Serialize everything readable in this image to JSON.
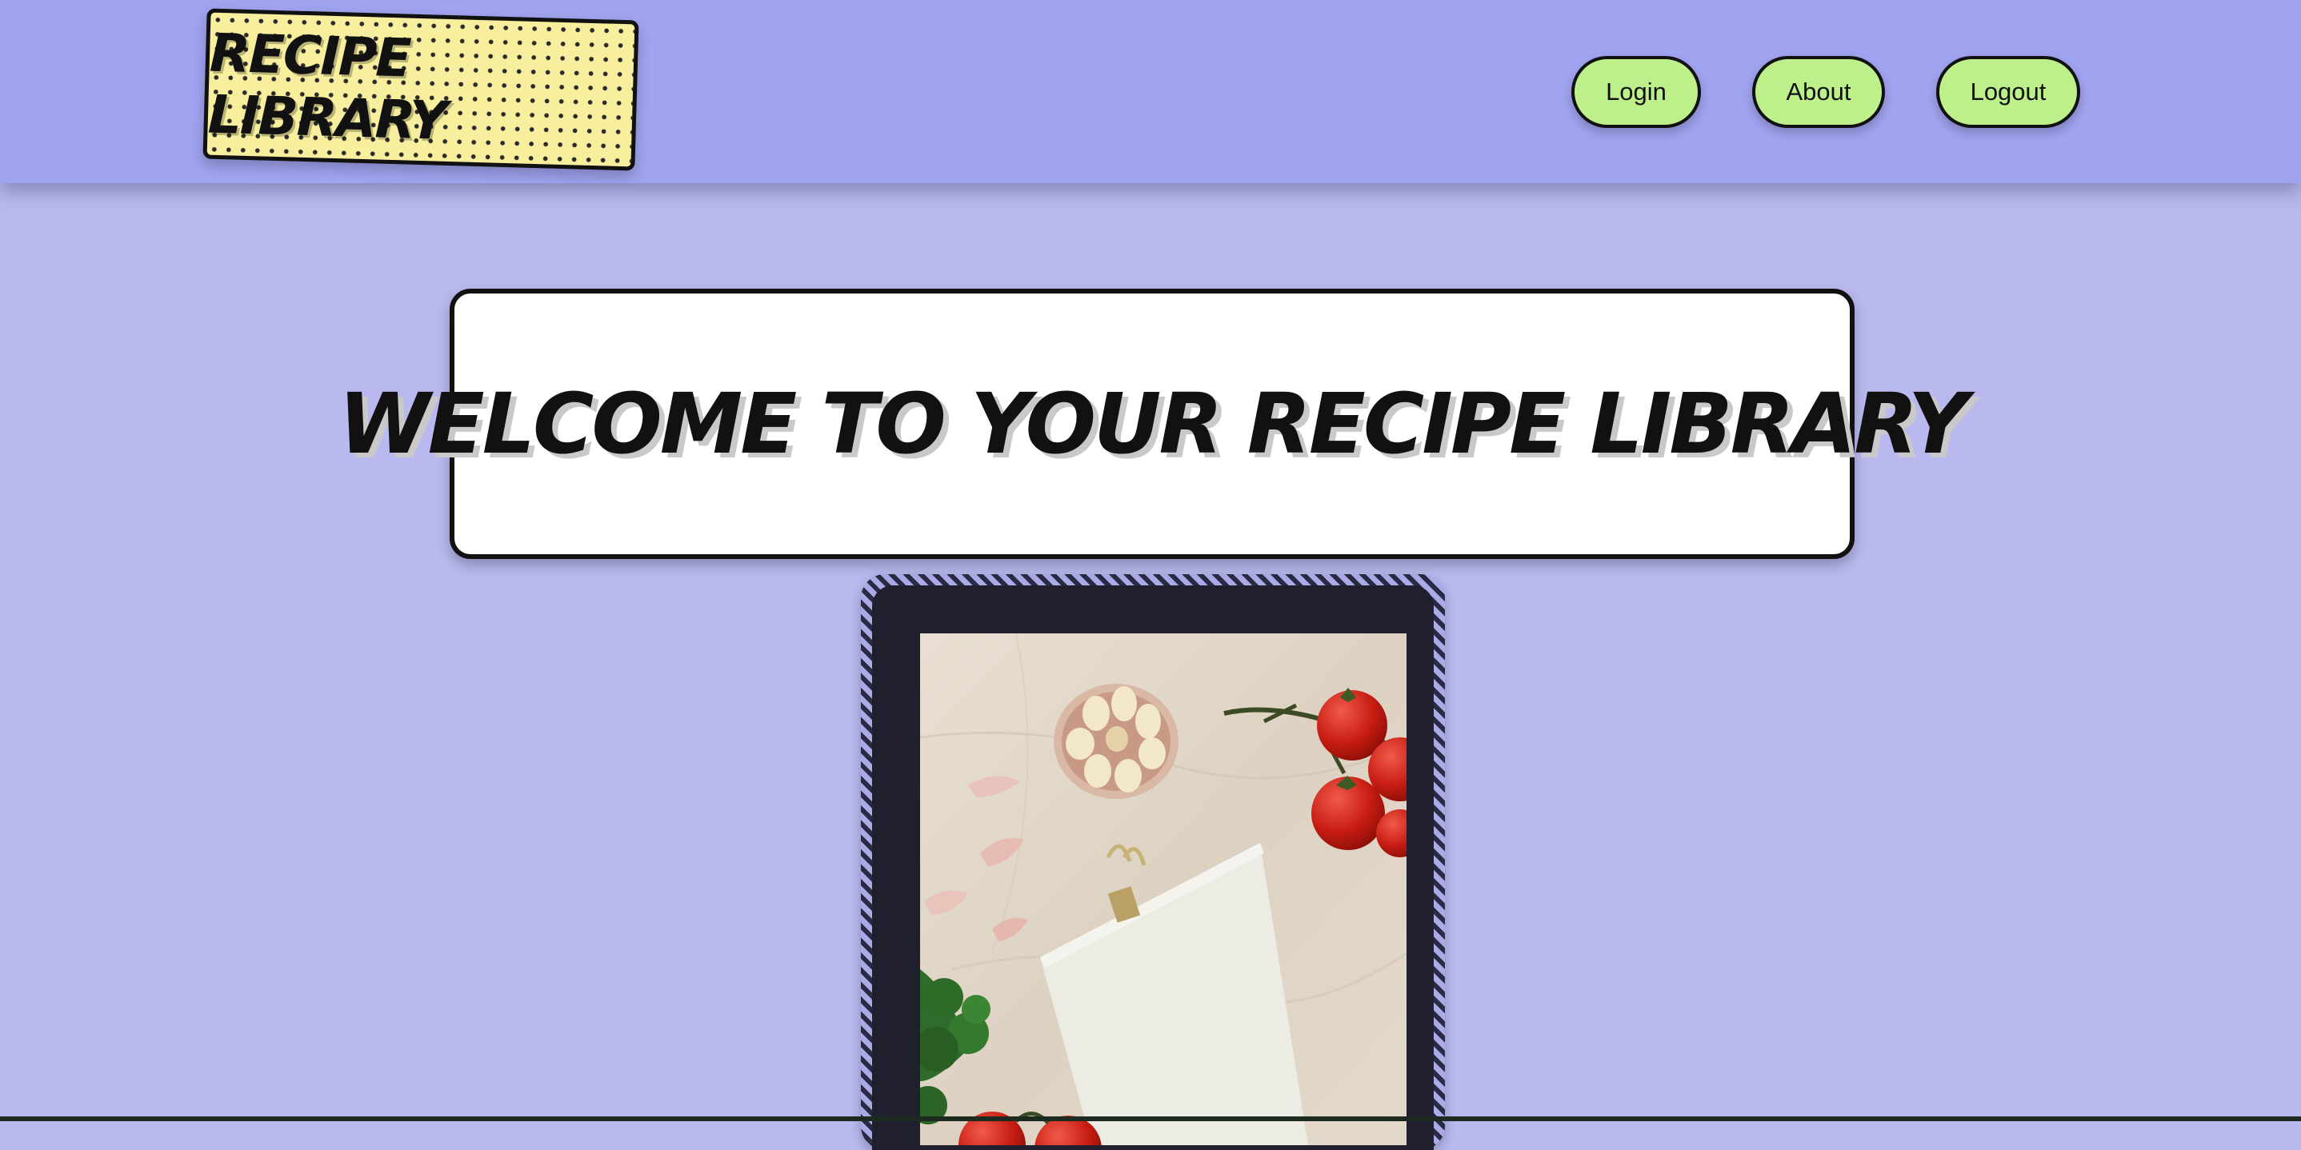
{
  "header": {
    "logo_text": "Recipe Library",
    "nav": [
      {
        "label": "Login"
      },
      {
        "label": "About"
      },
      {
        "label": "Logout"
      }
    ]
  },
  "main": {
    "welcome_title": "Welcome to your recipe library"
  },
  "colors": {
    "header_bg": "#a0a3ef",
    "page_bg": "#b9b9ef",
    "logo_bg": "#f7ef9d",
    "button_bg": "#bdf08a"
  }
}
